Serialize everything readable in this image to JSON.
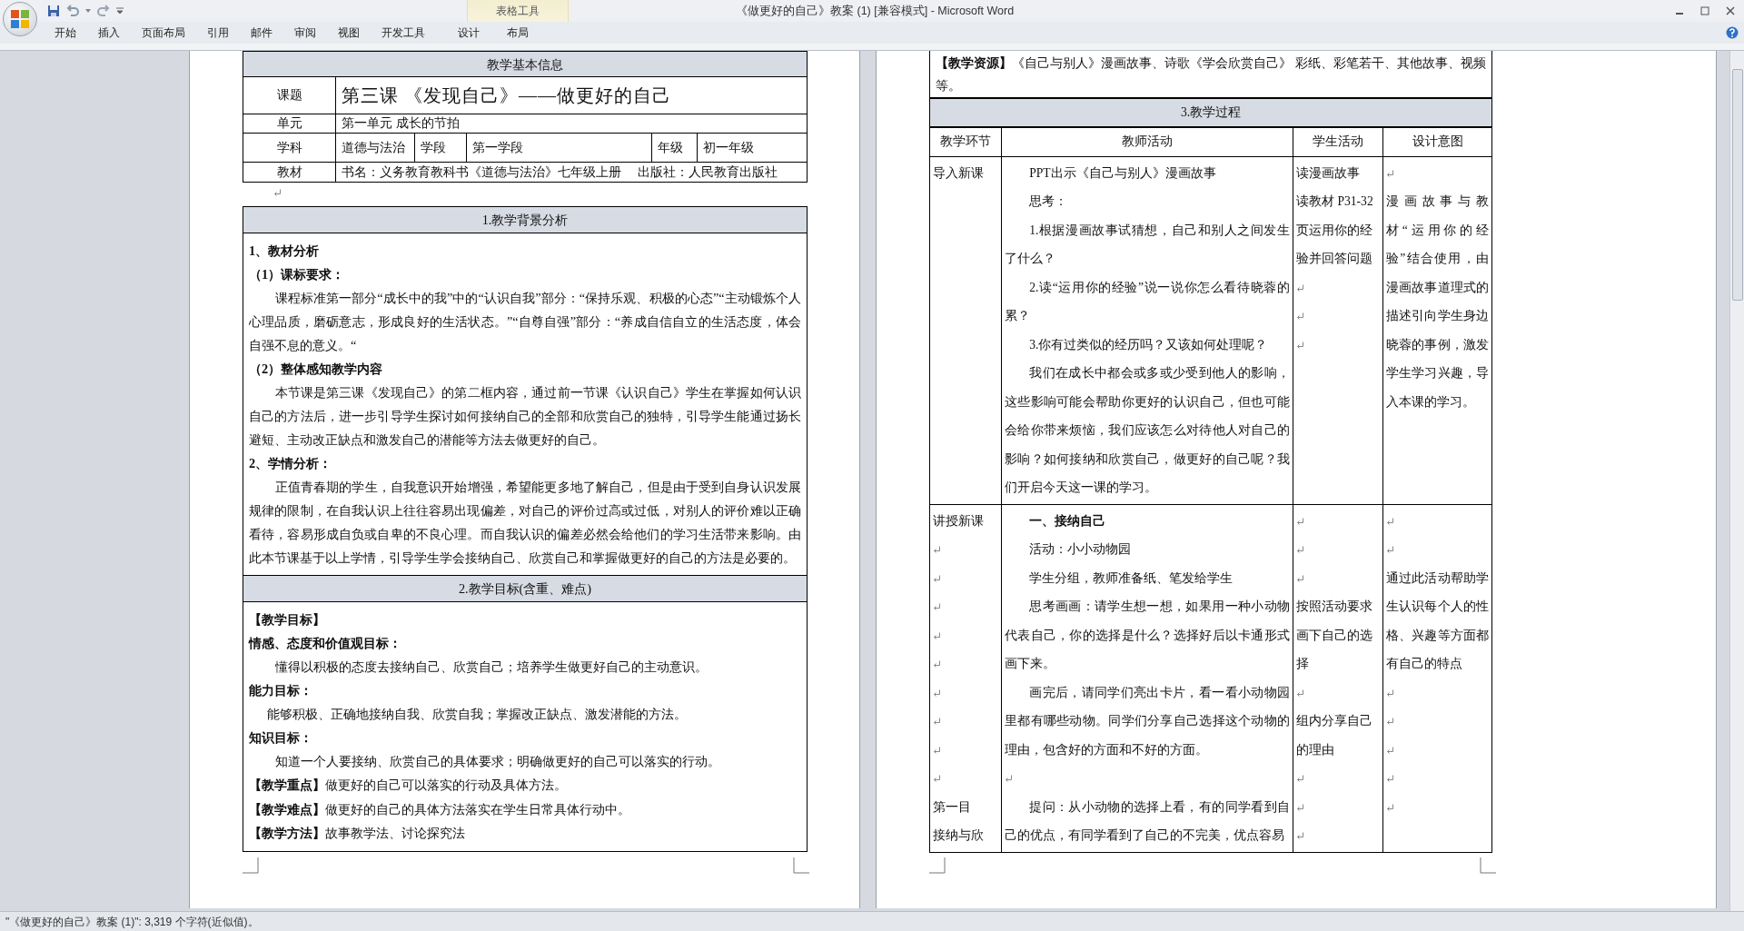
{
  "window": {
    "title": "《做更好的自己》教案 (1) [兼容模式] - Microsoft Word"
  },
  "ribbon": {
    "tabs": [
      "开始",
      "插入",
      "页面布局",
      "引用",
      "邮件",
      "审阅",
      "视图",
      "开发工具"
    ],
    "context_group": {
      "label": "表格工具",
      "tabs": [
        "设计",
        "布局"
      ]
    }
  },
  "left_page": {
    "info_table": {
      "header": "教学基本信息",
      "entries": [
        {
          "kind": "title",
          "label": "课题",
          "value": "第三课 《发现自己》——做更好的自己"
        },
        {
          "kind": "plain",
          "label": "单元",
          "value": "第一单元 成长的节拍"
        },
        {
          "kind": "pairs",
          "pairs": [
            {
              "label": "学科",
              "value": "道德与法治"
            },
            {
              "label": "学段",
              "value": "第一学段"
            },
            {
              "label": "年级",
              "value": "初一年级"
            }
          ]
        },
        {
          "kind": "plain",
          "label": "教材",
          "value": "书名：义务教育教科书《道德与法治》七年级上册　 出版社：人民教育出版社"
        }
      ]
    },
    "sections": [
      {
        "header": "1.教学背景分析",
        "paragraphs": [
          {
            "kind": "heading",
            "text": "1、教材分析"
          },
          {
            "kind": "heading",
            "text": "（1）课标要求："
          },
          {
            "kind": "body",
            "text": "课程标准第一部分“成长中的我”中的“认识自我”部分：“保持乐观、积极的心态”“主动锻炼个人心理品质，磨砺意志，形成良好的生活状态。”“自尊自强”部分：“养成自信自立的生活态度，体会自强不息的意义。“"
          },
          {
            "kind": "heading",
            "text": "（2）整体感知教学内容"
          },
          {
            "kind": "body",
            "text": "本节课是第三课《发现自己》的第二框内容，通过前一节课《认识自己》学生在掌握如何认识自己的方法后，进一步引导学生探讨如何接纳自己的全部和欣赏自己的独特，引导学生能通过扬长避短、主动改正缺点和激发自己的潜能等方法去做更好的自己。"
          },
          {
            "kind": "heading",
            "text": "2、学情分析："
          },
          {
            "kind": "body",
            "text": "正值青春期的学生，自我意识开始增强，希望能更多地了解自己，但是由于受到自身认识发展规律的限制，在自我认识上往往容易出现偏差，对自己的评价过高或过低，对别人的评价难以正确看待，容易形成自负或自卑的不良心理。而自我认识的偏差必然会给他们的学习生活带来影响。由此本节课基于以上学情，引导学生学会接纳自己、欣赏自己和掌握做更好的自己的方法是必要的。"
          }
        ]
      },
      {
        "header": "2.教学目标(含重、难点)",
        "paragraphs": [
          {
            "kind": "heading",
            "text": "【教学目标】"
          },
          {
            "kind": "heading",
            "text": "情感、态度和价值观目标："
          },
          {
            "kind": "body",
            "text": "懂得以积极的态度去接纳自己、欣赏自己；培养学生做更好自己的主动意识。"
          },
          {
            "kind": "heading",
            "text": "能力目标："
          },
          {
            "kind": "body_narrow",
            "text": "能够积极、正确地接纳自我、欣赏自我；掌握改正缺点、激发潜能的方法。"
          },
          {
            "kind": "heading",
            "text": "知识目标："
          },
          {
            "kind": "body",
            "text": "知道一个人要接纳、欣赏自己的具体要求；明确做更好的自己可以落实的行动。"
          },
          {
            "kind": "labeled",
            "text": "**【教学重点】**做更好的自己可以落实的行动及具体方法。"
          },
          {
            "kind": "labeled",
            "text": "**【教学难点】**做更好的自己的具体方法落实在学生日常具体行动中。"
          },
          {
            "kind": "labeled",
            "text": "**【教学方法】**故事教学法、讨论探究法"
          }
        ]
      }
    ]
  },
  "right_page": {
    "resources": "**【教学资源】**《自己与别人》漫画故事、诗歌《学会欣赏自己》 彩纸、彩笔若干、其他故事、视频等。",
    "process_table": {
      "header": "3.教学过程",
      "columns": [
        "教学环节",
        "教师活动",
        "学生活动",
        "设计意图"
      ],
      "rows": [
        {
          "cells": [
            [
              {
                "kind": "plain",
                "text": "导入新课"
              }
            ],
            [
              {
                "kind": "indented",
                "text": "PPT出示《自己与别人》漫画故事"
              },
              {
                "kind": "indented",
                "text": "思考："
              },
              {
                "kind": "indented",
                "text": "1.根据漫画故事试猜想，自己和别人之间发生了什么？"
              },
              {
                "kind": "indented",
                "text": "2.读“运用你的经验”说一说你怎么看待晓蓉的累？"
              },
              {
                "kind": "indented",
                "text": "3.你有过类似的经历吗？又该如何处理呢？"
              },
              {
                "kind": "indented",
                "text": "我们在成长中都会或多或少受到他人的影响，这些影响可能会帮助你更好的认识自己，但也可能会给你带来烦恼，我们应该怎么对待他人对自己的影响？如何接纳和欣赏自己，做更好的自己呢？我们开启今天这一课的学习。"
              }
            ],
            [
              {
                "kind": "plain",
                "text": "读漫画故事"
              },
              {
                "kind": "plain",
                "text": "读教材 P31-32页运用你的经验并回答问题"
              },
              {
                "kind": "blank"
              },
              {
                "kind": "blank"
              },
              {
                "kind": "blank"
              }
            ],
            [
              {
                "kind": "blank"
              },
              {
                "kind": "plain",
                "text": "漫画故事与教材“运用你的经验”结合使用，由漫画故事道理式的描述引向学生身边晓蓉的事例，激发学生学习兴趣，导入本课的学习。"
              }
            ]
          ]
        },
        {
          "cells": [
            [
              {
                "kind": "plain",
                "text": "讲授新课"
              },
              {
                "kind": "blank"
              },
              {
                "kind": "blank"
              },
              {
                "kind": "blank"
              },
              {
                "kind": "blank"
              },
              {
                "kind": "blank"
              },
              {
                "kind": "blank"
              },
              {
                "kind": "blank"
              },
              {
                "kind": "blank"
              },
              {
                "kind": "blank"
              },
              {
                "kind": "plain",
                "text": "第一目"
              },
              {
                "kind": "plain",
                "text": "接纳与欣"
              }
            ],
            [
              {
                "kind": "bold_indented",
                "text": "一、接纳自己"
              },
              {
                "kind": "indented",
                "text": "活动：小小动物园"
              },
              {
                "kind": "indented",
                "text": "学生分组，教师准备纸、笔发给学生"
              },
              {
                "kind": "indented",
                "text": "思考画画：请学生想一想，如果用一种小动物代表自己，你的选择是什么？选择好后以卡通形式画下来。"
              },
              {
                "kind": "indented",
                "text": "画完后，请同学们亮出卡片，看一看小动物园里都有哪些动物。同学们分享自己选择这个动物的理由，包含好的方面和不好的方面。"
              },
              {
                "kind": "blank"
              },
              {
                "kind": "indented",
                "text": "提问：从小动物的选择上看，有的同学看到自己的优点，有同学看到了自己的不完美，优点容易"
              }
            ],
            [
              {
                "kind": "blank"
              },
              {
                "kind": "blank"
              },
              {
                "kind": "blank"
              },
              {
                "kind": "plain",
                "text": "按照活动要求画下自己的选择"
              },
              {
                "kind": "blank"
              },
              {
                "kind": "plain",
                "text": "组内分享自己的理由"
              },
              {
                "kind": "blank"
              },
              {
                "kind": "blank"
              },
              {
                "kind": "blank"
              }
            ],
            [
              {
                "kind": "blank"
              },
              {
                "kind": "blank"
              },
              {
                "kind": "plain",
                "text": "通过此活动帮助学生认识每个人的性格、兴趣等方面都有自己的特点"
              },
              {
                "kind": "blank"
              },
              {
                "kind": "blank"
              },
              {
                "kind": "blank"
              },
              {
                "kind": "blank"
              },
              {
                "kind": "blank"
              }
            ]
          ]
        }
      ]
    }
  },
  "status_bar": {
    "text": "\"《做更好的自己》教案 (1)\": 3,319 个字符(近似值)。"
  }
}
